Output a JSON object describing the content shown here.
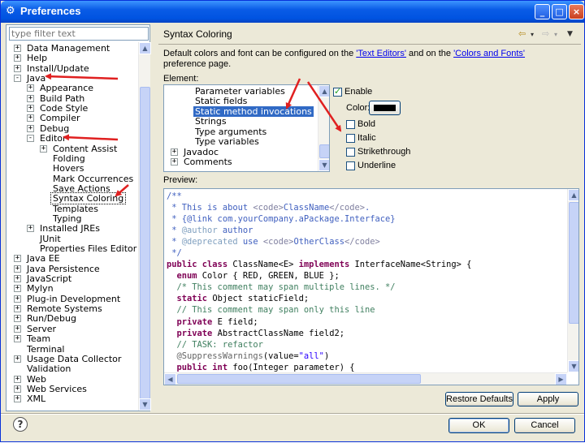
{
  "window": {
    "title": "Preferences",
    "minimize": "_",
    "maximize": "□",
    "close": "×"
  },
  "left": {
    "filter_placeholder": "type filter text",
    "tree": [
      {
        "label": "Data Management",
        "level": 0,
        "exp": "+"
      },
      {
        "label": "Help",
        "level": 0,
        "exp": "+"
      },
      {
        "label": "Install/Update",
        "level": 0,
        "exp": "+"
      },
      {
        "label": "Java",
        "level": 0,
        "exp": "-"
      },
      {
        "label": "Appearance",
        "level": 1,
        "exp": "+"
      },
      {
        "label": "Build Path",
        "level": 1,
        "exp": "+"
      },
      {
        "label": "Code Style",
        "level": 1,
        "exp": "+"
      },
      {
        "label": "Compiler",
        "level": 1,
        "exp": "+"
      },
      {
        "label": "Debug",
        "level": 1,
        "exp": "+"
      },
      {
        "label": "Editor",
        "level": 1,
        "exp": "-"
      },
      {
        "label": "Content Assist",
        "level": 2,
        "exp": "+"
      },
      {
        "label": "Folding",
        "level": 2,
        "exp": ""
      },
      {
        "label": "Hovers",
        "level": 2,
        "exp": ""
      },
      {
        "label": "Mark Occurrences",
        "level": 2,
        "exp": ""
      },
      {
        "label": "Save Actions",
        "level": 2,
        "exp": ""
      },
      {
        "label": "Syntax Coloring",
        "level": 2,
        "exp": "",
        "selected": true
      },
      {
        "label": "Templates",
        "level": 2,
        "exp": ""
      },
      {
        "label": "Typing",
        "level": 2,
        "exp": ""
      },
      {
        "label": "Installed JREs",
        "level": 1,
        "exp": "+"
      },
      {
        "label": "JUnit",
        "level": 1,
        "exp": ""
      },
      {
        "label": "Properties Files Editor",
        "level": 1,
        "exp": ""
      },
      {
        "label": "Java EE",
        "level": 0,
        "exp": "+"
      },
      {
        "label": "Java Persistence",
        "level": 0,
        "exp": "+"
      },
      {
        "label": "JavaScript",
        "level": 0,
        "exp": "+"
      },
      {
        "label": "Mylyn",
        "level": 0,
        "exp": "+"
      },
      {
        "label": "Plug-in Development",
        "level": 0,
        "exp": "+"
      },
      {
        "label": "Remote Systems",
        "level": 0,
        "exp": "+"
      },
      {
        "label": "Run/Debug",
        "level": 0,
        "exp": "+"
      },
      {
        "label": "Server",
        "level": 0,
        "exp": "+"
      },
      {
        "label": "Team",
        "level": 0,
        "exp": "+"
      },
      {
        "label": "Terminal",
        "level": 0,
        "exp": ""
      },
      {
        "label": "Usage Data Collector",
        "level": 0,
        "exp": "+"
      },
      {
        "label": "Validation",
        "level": 0,
        "exp": ""
      },
      {
        "label": "Web",
        "level": 0,
        "exp": "+"
      },
      {
        "label": "Web Services",
        "level": 0,
        "exp": "+"
      },
      {
        "label": "XML",
        "level": 0,
        "exp": "+"
      }
    ]
  },
  "page": {
    "title": "Syntax Coloring",
    "desc_pre": "Default colors and font can be configured on the ",
    "link1": "'Text Editors'",
    "desc_mid": " and on the ",
    "link2": "'Colors and Fonts'",
    "desc_post": " preference page.",
    "element_label": "Element:",
    "elements": [
      {
        "label": "Parameter variables",
        "level": 1,
        "exp": ""
      },
      {
        "label": "Static fields",
        "level": 1,
        "exp": ""
      },
      {
        "label": "Static method invocations",
        "level": 1,
        "exp": "",
        "selected": true
      },
      {
        "label": "Strings",
        "level": 1,
        "exp": ""
      },
      {
        "label": "Type arguments",
        "level": 1,
        "exp": ""
      },
      {
        "label": "Type variables",
        "level": 1,
        "exp": ""
      },
      {
        "label": "Javadoc",
        "level": 0,
        "exp": "+"
      },
      {
        "label": "Comments",
        "level": 0,
        "exp": "+"
      }
    ],
    "enable_label": "Enable",
    "enable_checked": true,
    "color_label": "Color:",
    "color_value": "#000000",
    "bold_label": "Bold",
    "italic_label": "Italic",
    "strike_label": "Strikethrough",
    "underline_label": "Underline",
    "preview_label": "Preview:",
    "restore_label": "Restore Defaults",
    "apply_label": "Apply"
  },
  "preview_lines": [
    [
      [
        "/**",
        "#3f5fbf"
      ]
    ],
    [
      [
        " * This is about ",
        "#3f5fbf"
      ],
      [
        "<code>",
        "#7f7f9f"
      ],
      [
        "ClassName",
        "#3f5fbf"
      ],
      [
        "</code>",
        "#7f7f9f"
      ],
      [
        ".",
        "#3f5fbf"
      ]
    ],
    [
      [
        " * {@link com.yourCompany.aPackage.Interface}",
        "#3f5fbf"
      ]
    ],
    [
      [
        " * ",
        "#3f5fbf"
      ],
      [
        "@author",
        "#7f9fbf"
      ],
      [
        " author",
        "#3f5fbf"
      ]
    ],
    [
      [
        " * ",
        "#3f5fbf"
      ],
      [
        "@deprecated",
        "#7f9fbf"
      ],
      [
        " use ",
        "#3f5fbf"
      ],
      [
        "<code>",
        "#7f7f9f"
      ],
      [
        "OtherClass",
        "#3f5fbf"
      ],
      [
        "</code>",
        "#7f7f9f"
      ]
    ],
    [
      [
        " */",
        "#3f5fbf"
      ]
    ],
    [
      [
        "public class ",
        "#7f0055",
        true
      ],
      [
        "ClassName<E> ",
        "#000000"
      ],
      [
        "implements ",
        "#7f0055",
        true
      ],
      [
        "InterfaceName<String> {",
        "#000000"
      ]
    ],
    [
      [
        "  ",
        "#000"
      ],
      [
        "enum ",
        "#7f0055",
        true
      ],
      [
        "Color { RED, GREEN, BLUE };",
        "#000000"
      ]
    ],
    [
      [
        "  /* This comment may span multiple lines. */",
        "#3f7f5f"
      ]
    ],
    [
      [
        "  ",
        "#000"
      ],
      [
        "static ",
        "#7f0055",
        true
      ],
      [
        "Object staticField;",
        "#000000"
      ]
    ],
    [
      [
        "  // This comment may span only this line",
        "#3f7f5f"
      ]
    ],
    [
      [
        "  ",
        "#000"
      ],
      [
        "private ",
        "#7f0055",
        true
      ],
      [
        "E field;",
        "#000000"
      ]
    ],
    [
      [
        "  ",
        "#000"
      ],
      [
        "private ",
        "#7f0055",
        true
      ],
      [
        "AbstractClassName field2;",
        "#000000"
      ]
    ],
    [
      [
        "  // TASK: refactor",
        "#3f7f5f"
      ]
    ],
    [
      [
        "  @SuppressWarnings",
        "#646464"
      ],
      [
        "(value=",
        "#000000"
      ],
      [
        "\"all\"",
        "#2a00ff"
      ],
      [
        ")",
        "#000000"
      ]
    ],
    [
      [
        "  ",
        "#000"
      ],
      [
        "public int ",
        "#7f0055",
        true
      ],
      [
        "foo(Integer parameter) {",
        "#000000"
      ]
    ]
  ],
  "footer": {
    "help_icon": "?",
    "ok_label": "OK",
    "cancel_label": "Cancel"
  }
}
